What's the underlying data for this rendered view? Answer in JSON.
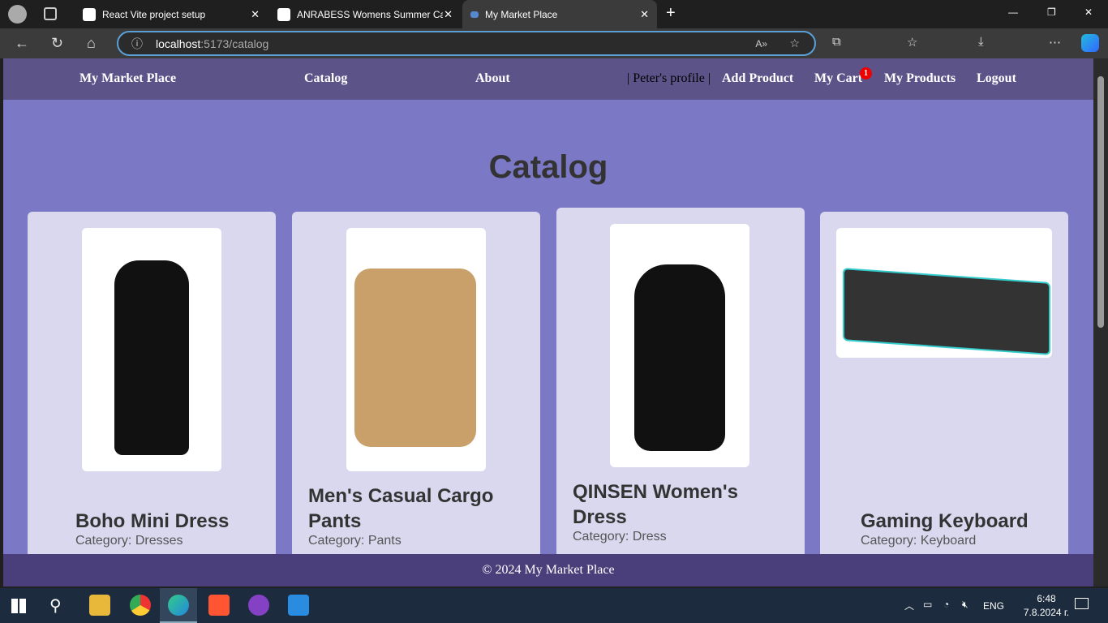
{
  "browser": {
    "tabs": [
      {
        "title": "React Vite project setup"
      },
      {
        "title": "ANRABESS Womens Summer Ca"
      },
      {
        "title": "My Market Place"
      }
    ],
    "url_host": "localhost",
    "url_rest": ":5173/catalog"
  },
  "nav": {
    "brand": "My Market Place",
    "catalog": "Catalog",
    "about": "About",
    "profile": "| Peter's profile |",
    "add_product": "Add Product",
    "my_cart": "My Cart",
    "cart_count": "1",
    "my_products": "My Products",
    "logout": "Logout"
  },
  "main": {
    "title": "Catalog",
    "products": [
      {
        "name": "Boho Mini Dress",
        "category": "Category: Dresses"
      },
      {
        "name": "Men's Casual Cargo Pants",
        "category": "Category: Pants"
      },
      {
        "name": "QINSEN Women's Dress",
        "category": "Category: Dress"
      },
      {
        "name": "Gaming Keyboard",
        "category": "Category: Keyboard"
      }
    ]
  },
  "footer": {
    "text": "© 2024 My Market Place"
  },
  "taskbar": {
    "lang": "ENG",
    "time": "6:48",
    "date": "7.8.2024 г."
  }
}
